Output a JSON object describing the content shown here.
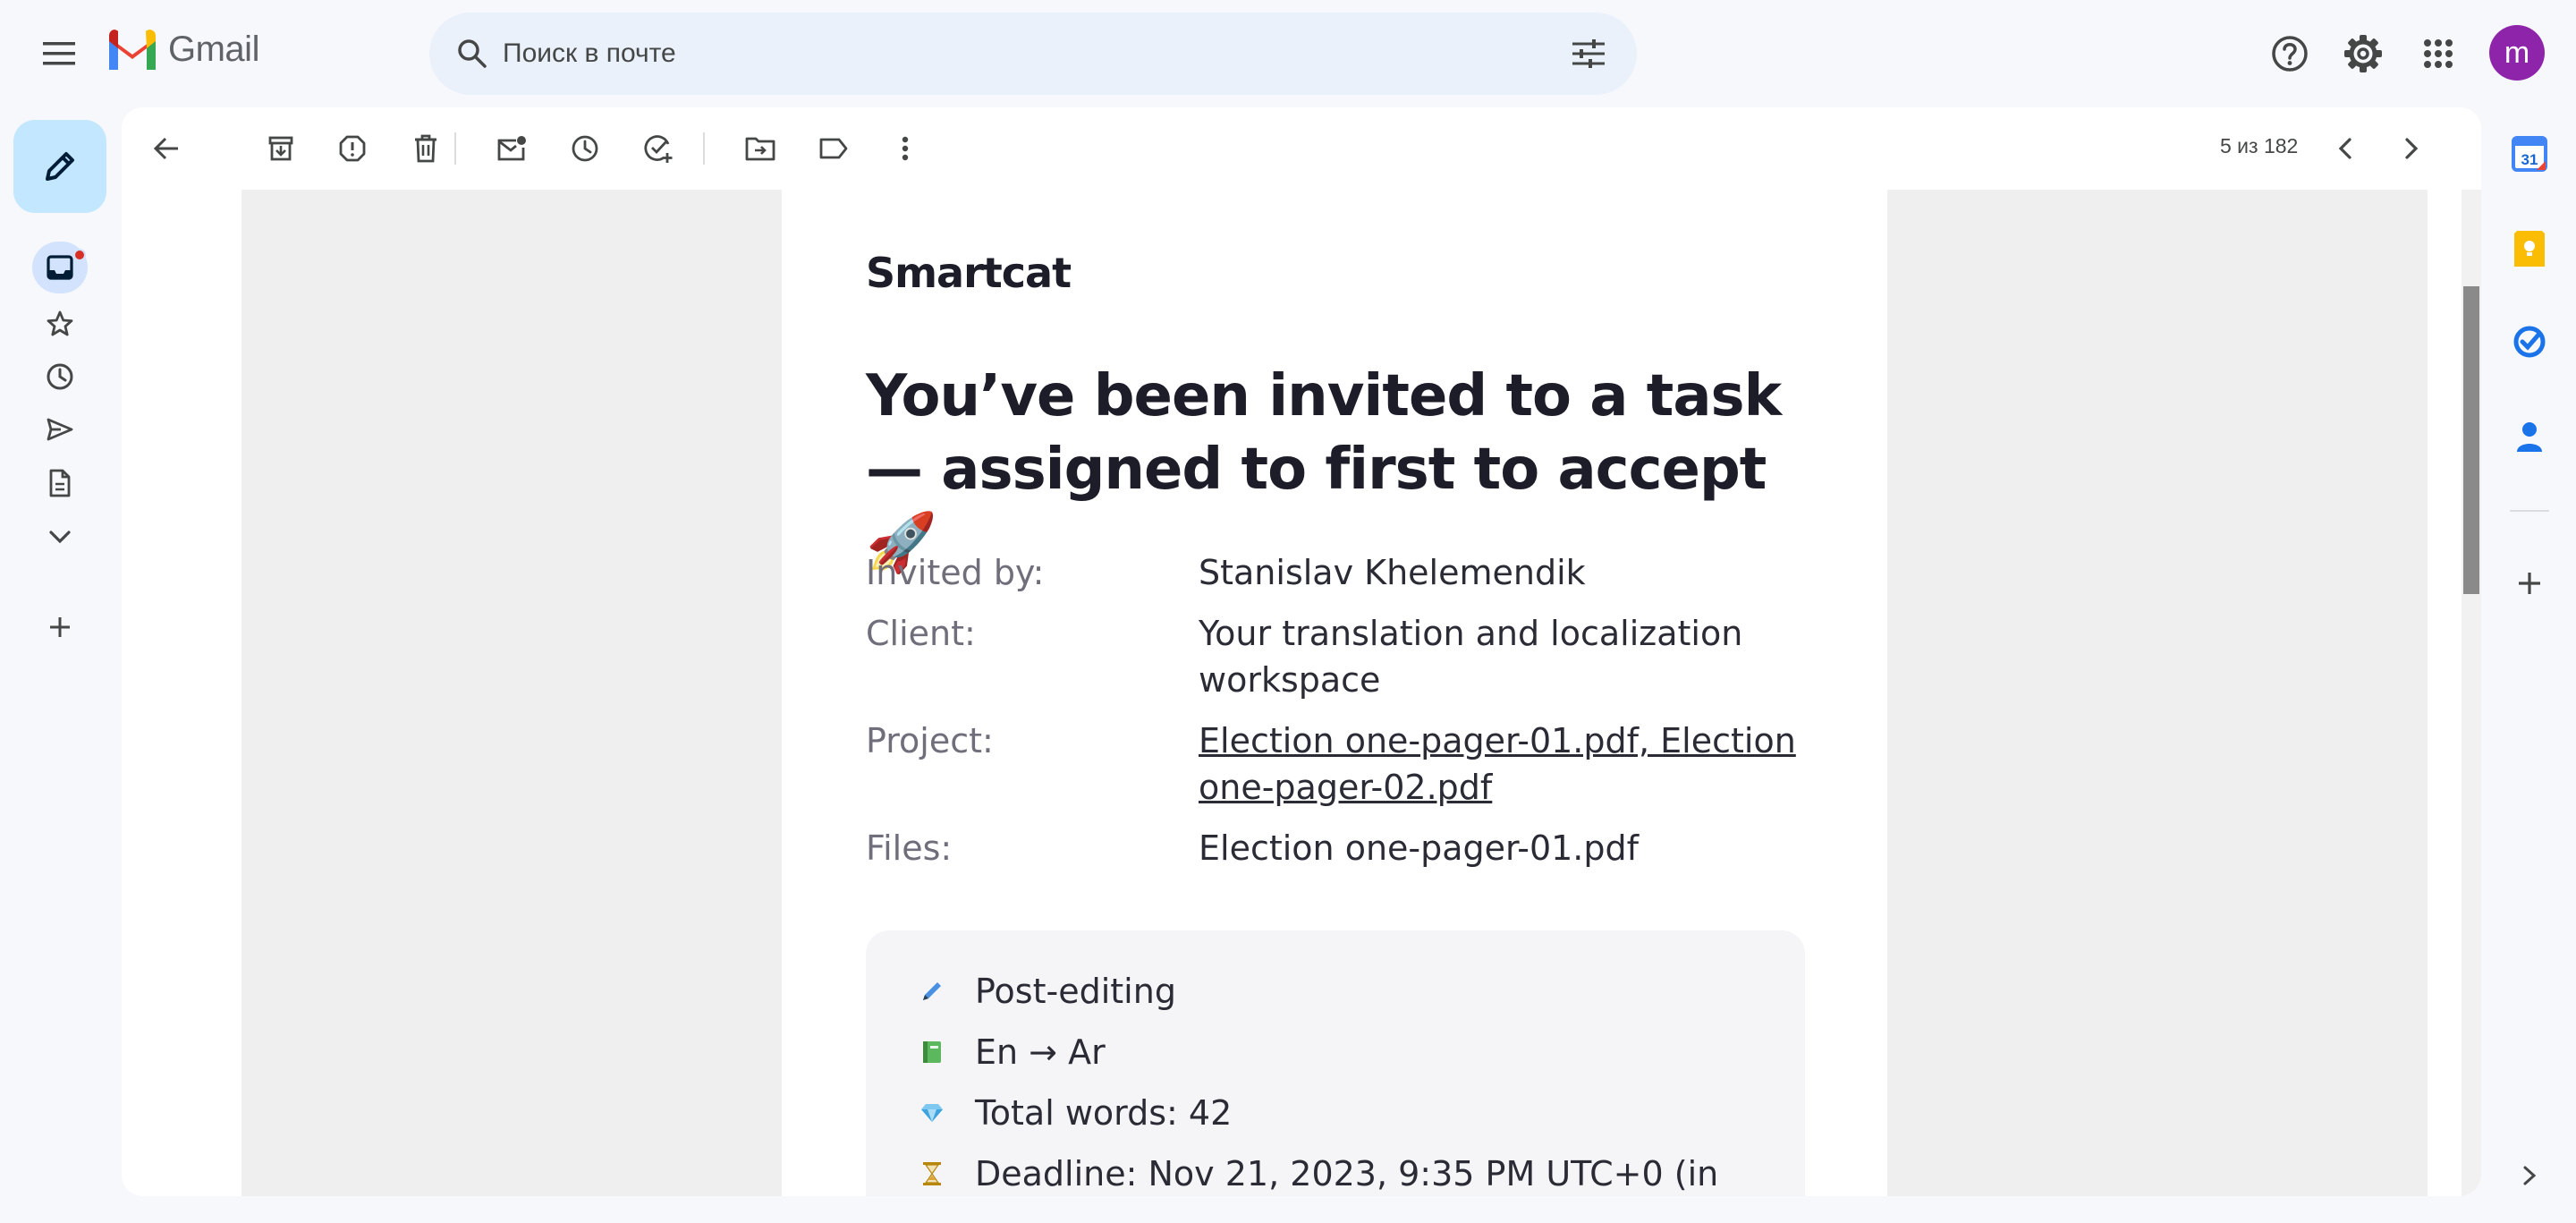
{
  "app": {
    "name": "Gmail"
  },
  "search": {
    "placeholder": "Поиск в почте"
  },
  "account": {
    "avatar_letter": "m",
    "avatar_color": "#8e24aa"
  },
  "toolbar": {
    "pager": "5 из 182"
  },
  "left_rail": {
    "items": [
      {
        "name": "inbox-icon",
        "active": true,
        "has_notification": true
      },
      {
        "name": "star-icon"
      },
      {
        "name": "clock-icon"
      },
      {
        "name": "send-icon"
      },
      {
        "name": "draft-icon"
      },
      {
        "name": "chevron-down-icon"
      },
      {
        "name": "plus-icon"
      }
    ]
  },
  "email": {
    "brand": "Smartcat",
    "headline": "You’ve been invited to a task — assigned to first to accept 🚀",
    "details": [
      {
        "label": "Invited by:",
        "value": "Stanislav Khelemendik",
        "link": false
      },
      {
        "label": "Client:",
        "value": "Your translation and localization workspace",
        "link": false
      },
      {
        "label": "Project:",
        "value": "Election one-pager-01.pdf, Election one-pager-02.pdf",
        "link": true
      },
      {
        "label": "Files:",
        "value": "Election one-pager-01.pdf",
        "link": false
      }
    ],
    "task": [
      {
        "icon": "pen-icon",
        "text": "Post-editing"
      },
      {
        "icon": "book-icon",
        "text": "En → Ar"
      },
      {
        "icon": "gem-icon",
        "text": "Total words: 42"
      },
      {
        "icon": "hourglass-icon",
        "text": "Deadline: Nov 21, 2023, 9:35 PM UTC+0 (in"
      }
    ]
  },
  "colors": {
    "background": "#f6f8fc",
    "compose": "#c2e7ff",
    "search": "#eaf1fb"
  }
}
